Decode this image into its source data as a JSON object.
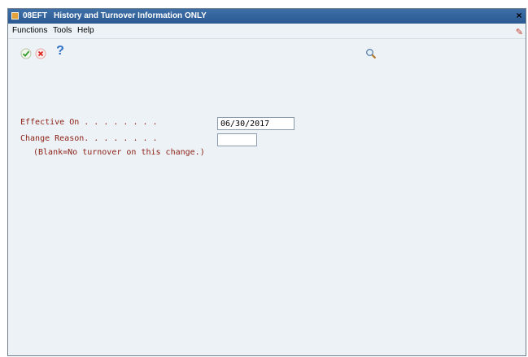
{
  "window": {
    "title_code": "08EFT",
    "title": "History and Turnover Information ONLY"
  },
  "menu": {
    "items": [
      {
        "label": "Functions"
      },
      {
        "label": "Tools"
      },
      {
        "label": "Help"
      }
    ]
  },
  "toolbar": {
    "ok_icon": "checkmark-icon",
    "cancel_icon": "x-icon",
    "help_label": "?",
    "search_icon": "magnifier-icon"
  },
  "form": {
    "effective_on_label": "Effective On . . . . . . . .",
    "effective_on_value": "06/30/2017",
    "change_reason_label": "Change Reason. . . . . . . .",
    "change_reason_value": "",
    "note": "(Blank=No turnover on this change.)"
  },
  "colors": {
    "title_bar": "#2b5a93",
    "label_text": "#8c1f14",
    "window_bg": "#edf2f6"
  }
}
